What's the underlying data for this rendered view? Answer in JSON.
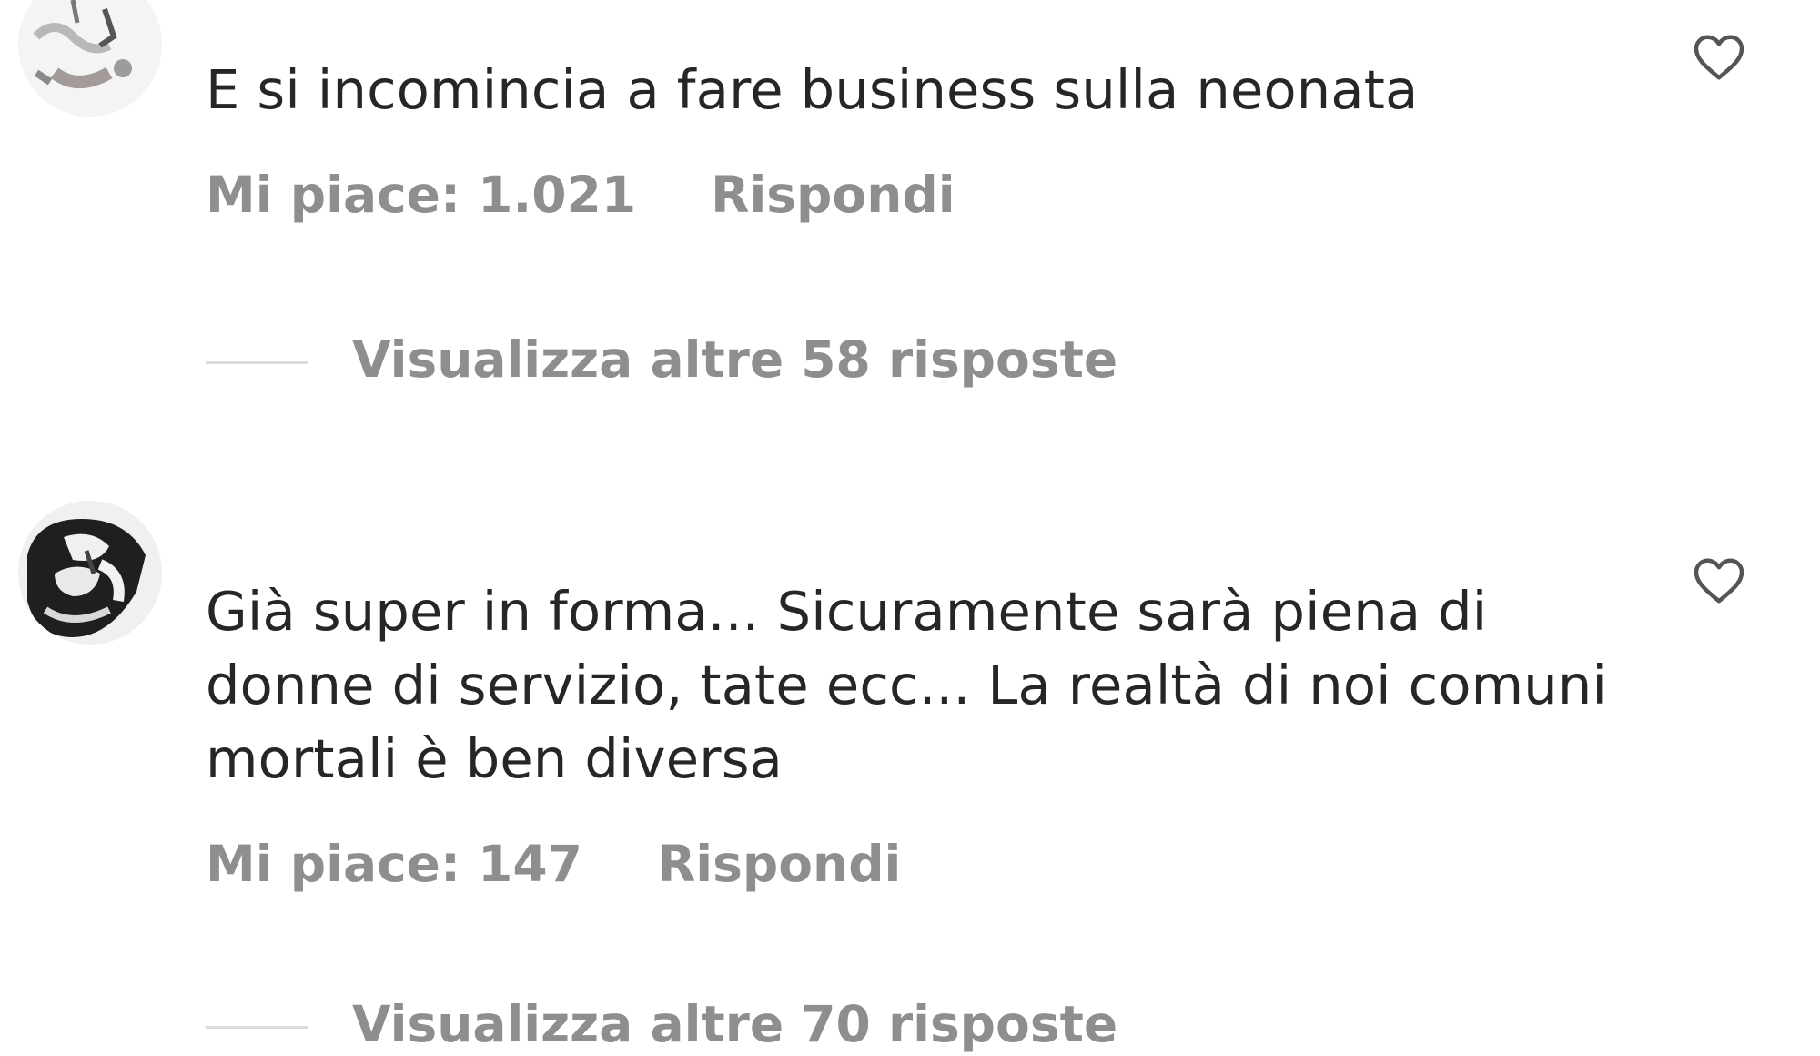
{
  "comments": [
    {
      "text": "E si incomincia a fare business sulla neonata",
      "likes": "Mi piace: 1.021",
      "reply": "Rispondi",
      "view_replies": "Visualizza altre 58 risposte"
    },
    {
      "text": "Già super in forma... Sicuramente sarà piena di donne di servizio, tate ecc... La realtà di noi comuni mortali è ben diversa",
      "likes": "Mi piace: 147",
      "reply": "Rispondi",
      "view_replies": "Visualizza altre 70 risposte"
    }
  ],
  "icons": {
    "like": "heart-outline-icon",
    "avatar": "user-avatar"
  },
  "colors": {
    "text": "#262626",
    "secondary": "#8e8e8e",
    "divider": "#dbdbdb",
    "background": "#ffffff"
  }
}
